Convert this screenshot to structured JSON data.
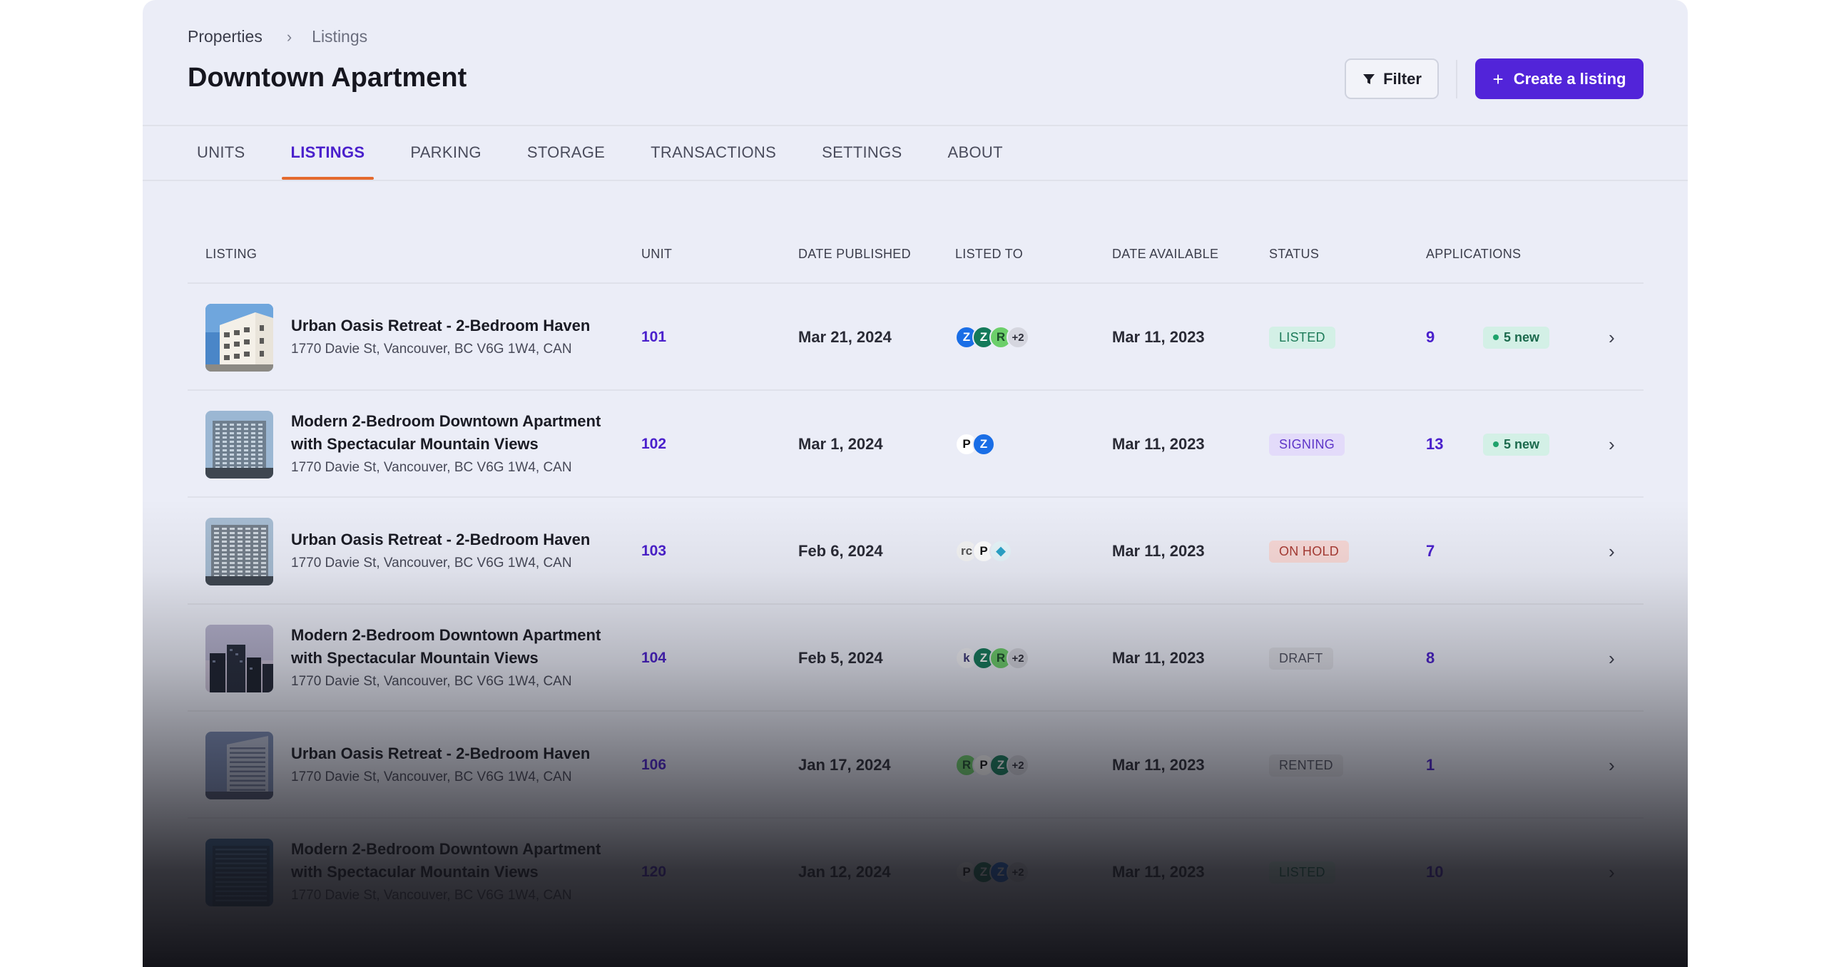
{
  "breadcrumb": {
    "parent": "Properties",
    "separator": "›",
    "current": "Listings"
  },
  "page": {
    "title": "Downtown Apartment"
  },
  "actions": {
    "filter_label": "Filter",
    "create_label": "Create a listing",
    "create_icon": "+"
  },
  "tabs": [
    {
      "label": "UNITS",
      "active": false
    },
    {
      "label": "LISTINGS",
      "active": true
    },
    {
      "label": "PARKING",
      "active": false
    },
    {
      "label": "STORAGE",
      "active": false
    },
    {
      "label": "TRANSACTIONS",
      "active": false
    },
    {
      "label": "SETTINGS",
      "active": false
    },
    {
      "label": "ABOUT",
      "active": false
    }
  ],
  "table": {
    "columns": [
      "LISTING",
      "UNIT",
      "DATE PUBLISHED",
      "LISTED TO",
      "DATE AVAILABLE",
      "STATUS",
      "APPLICATIONS"
    ],
    "rows": [
      {
        "title": "Urban Oasis Retreat - 2-Bedroom Haven",
        "address": "1770 Davie St, Vancouver, BC V6G 1W4, CAN",
        "unit": "101",
        "published": "Mar 21, 2024",
        "listed_to": [
          "zillow-logo",
          "zumper-logo",
          "rentals-logo"
        ],
        "listed_more": "+2",
        "available": "Mar 11, 2023",
        "status": "LISTED",
        "status_kind": "listed",
        "applications": "9",
        "new": "5 new"
      },
      {
        "title": "Modern 2-Bedroom Downtown Apartment with Spectacular Mountain Views",
        "address": "1770 Davie St, Vancouver, BC V6G 1W4, CAN",
        "unit": "102",
        "published": "Mar 1, 2024",
        "listed_to": [
          "padmapper-logo",
          "zillow-logo"
        ],
        "listed_more": "",
        "available": "Mar 11, 2023",
        "status": "SIGNING",
        "status_kind": "signing",
        "applications": "13",
        "new": "5 new"
      },
      {
        "title": "Urban Oasis Retreat - 2-Bedroom Haven",
        "address": "1770 Davie St, Vancouver, BC V6G 1W4, CAN",
        "unit": "103",
        "published": "Feb 6, 2024",
        "listed_to": [
          "rentcafe-logo",
          "padmapper-logo",
          "liv-logo"
        ],
        "listed_more": "",
        "available": "Mar 11, 2023",
        "status": "ON HOLD",
        "status_kind": "onhold",
        "applications": "7",
        "new": ""
      },
      {
        "title": "Modern 2-Bedroom Downtown Apartment with Spectacular Mountain Views",
        "address": "1770 Davie St, Vancouver, BC V6G 1W4, CAN",
        "unit": "104",
        "published": "Feb 5, 2024",
        "listed_to": [
          "kijiji-logo",
          "zumper-logo",
          "rentals-logo"
        ],
        "listed_more": "+2",
        "available": "Mar 11, 2023",
        "status": "DRAFT",
        "status_kind": "draft",
        "applications": "8",
        "new": ""
      },
      {
        "title": "Urban Oasis Retreat - 2-Bedroom Haven",
        "address": "1770 Davie St, Vancouver, BC V6G 1W4, CAN",
        "unit": "106",
        "published": "Jan 17, 2024",
        "listed_to": [
          "rentals-logo",
          "padmapper-logo",
          "zumper-logo"
        ],
        "listed_more": "+2",
        "available": "Mar 11, 2023",
        "status": "RENTED",
        "status_kind": "rented",
        "applications": "1",
        "new": ""
      },
      {
        "title": "Modern 2-Bedroom Downtown Apartment with Spectacular Mountain Views",
        "address": "1770 Davie St, Vancouver, BC V6G 1W4, CAN",
        "unit": "120",
        "published": "Jan 12, 2024",
        "listed_to": [
          "padmapper-logo",
          "zumper-logo",
          "zillow-logo"
        ],
        "listed_more": "+2",
        "available": "Mar 11, 2023",
        "status": "LISTED",
        "status_kind": "listed",
        "applications": "10",
        "new": ""
      }
    ]
  },
  "colors": {
    "accent": "#5224d9",
    "tab_underline": "#e46a2e",
    "background": "#ebedf7"
  }
}
